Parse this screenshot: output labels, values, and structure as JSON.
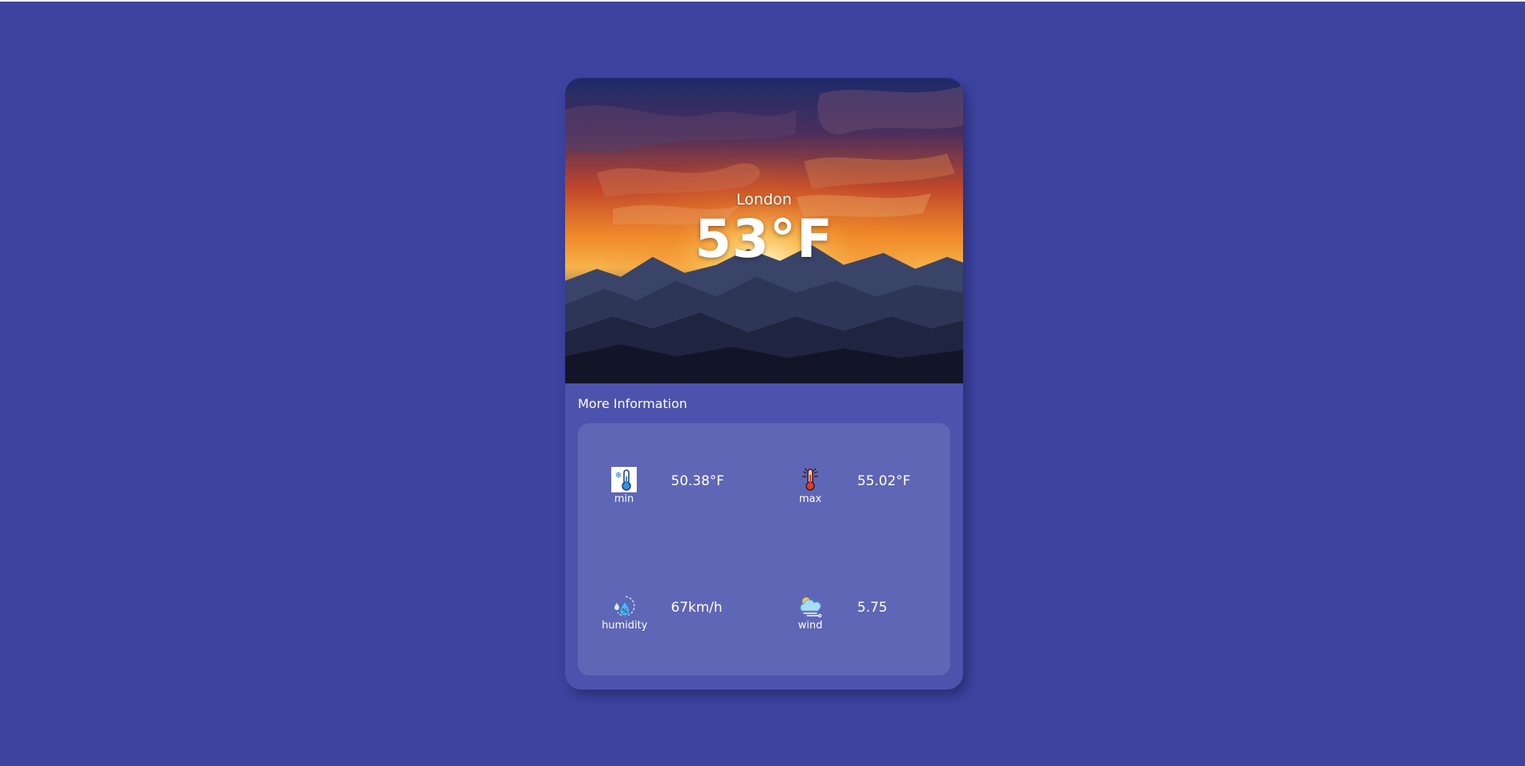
{
  "weather": {
    "city": "London",
    "temperature": "53°F"
  },
  "more_info": {
    "title": "More Information",
    "stats": [
      {
        "label": "min",
        "value": "50.38°F",
        "icon": "thermometer-cold-icon"
      },
      {
        "label": "max",
        "value": "55.02°F",
        "icon": "thermometer-hot-icon"
      },
      {
        "label": "humidity",
        "value": "67km/h",
        "icon": "humidity-icon"
      },
      {
        "label": "wind",
        "value": "5.75",
        "icon": "wind-cloud-icon"
      }
    ]
  },
  "colors": {
    "page_background": "#3d44a0",
    "card_background": "#4d52ad",
    "panel_background": "#5f66b6",
    "text": "#ffffff"
  }
}
